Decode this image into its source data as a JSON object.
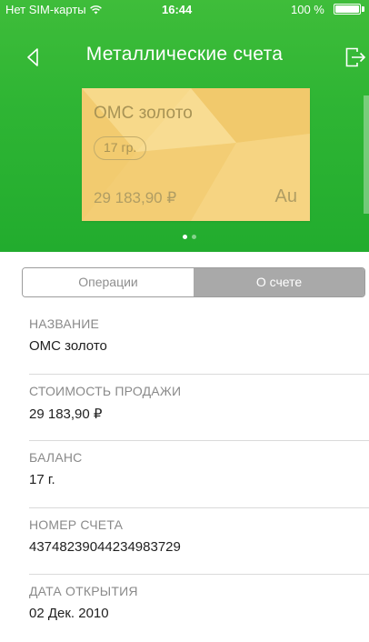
{
  "status_bar": {
    "carrier": "Нет SIM-карты",
    "time": "16:44",
    "battery": "100 %"
  },
  "nav": {
    "title": "Металлические счета"
  },
  "card": {
    "name": "ОМС золото",
    "weight": "17 гр.",
    "amount": "29 183,90 ₽",
    "metal_symbol": "Au",
    "color": "#f4d07a"
  },
  "pager": {
    "total": 2,
    "active_index": 0
  },
  "segmented_control": {
    "operations_label": "Операции",
    "account_label": "О счете",
    "selected": "account"
  },
  "details": [
    {
      "label": "НАЗВАНИЕ",
      "value": "ОМС золото"
    },
    {
      "label": "СТОИМОСТЬ ПРОДАЖИ",
      "value": "29 183,90 ₽"
    },
    {
      "label": "БАЛАНС",
      "value": "17 г."
    },
    {
      "label": "НОМЕР СЧЕТА",
      "value": "43748239044234983729"
    },
    {
      "label": "ДАТА ОТКРЫТИЯ",
      "value": "02 Дек. 2010"
    }
  ],
  "colors": {
    "header_green": "#2fb534",
    "card_gold": "#f4d07a",
    "segment_selected": "#a9a9a9"
  }
}
